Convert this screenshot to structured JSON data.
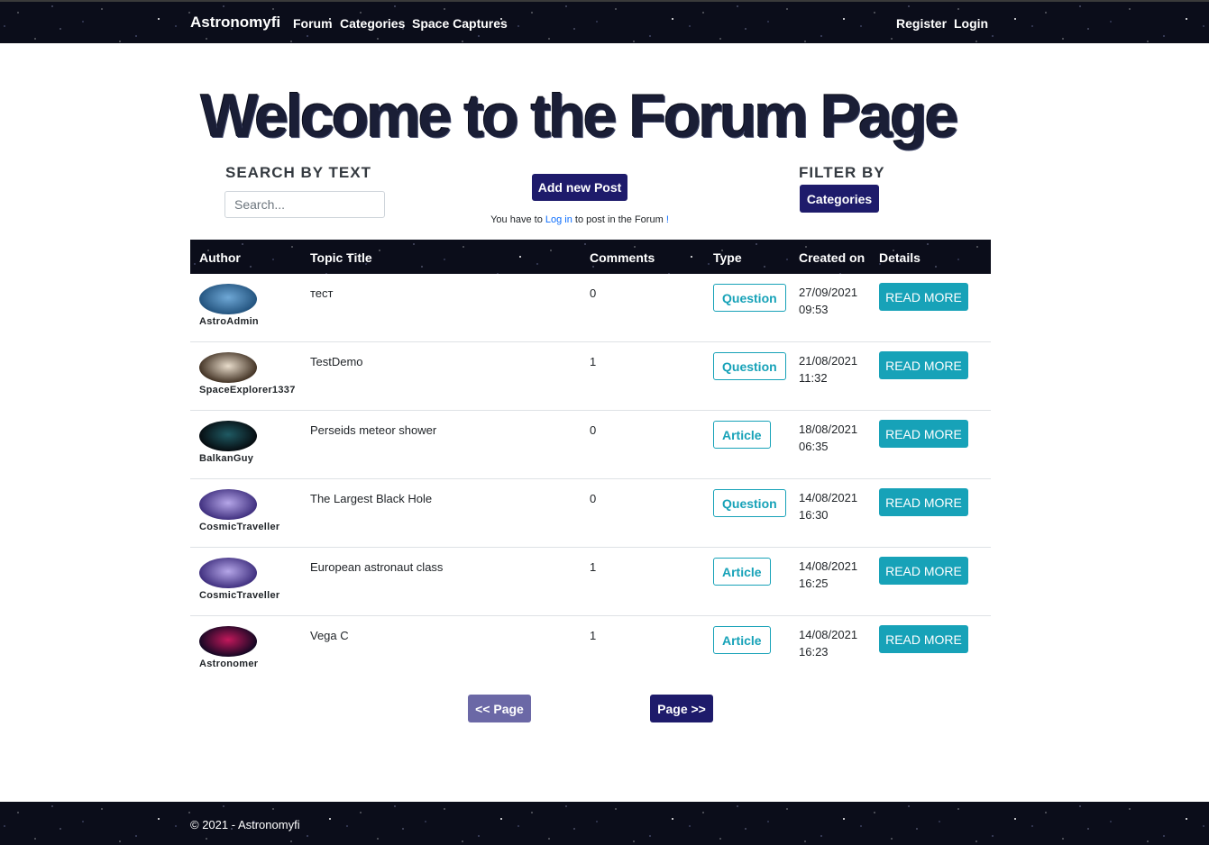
{
  "navbar": {
    "brand": "Astronomyfi",
    "links": [
      "Forum",
      "Categories",
      "Space Captures"
    ],
    "register": "Register",
    "login": "Login"
  },
  "hero": {
    "title": "Welcome to the Forum Page"
  },
  "search": {
    "heading": "SEARCH BY TEXT",
    "placeholder": "Search..."
  },
  "add_post": {
    "button": "Add new Post",
    "notice_before": "You have to",
    "notice_link": "Log in",
    "notice_after": "to post in the Forum",
    "notice_end": "!"
  },
  "filter": {
    "heading": "FILTER BY",
    "button": "Categories"
  },
  "table": {
    "headers": [
      "Author",
      "Topic Title",
      "Comments",
      "Type",
      "Created on",
      "Details"
    ],
    "rows": [
      {
        "author": "AstroAdmin",
        "title": "тест",
        "comments": "0",
        "type": "Question",
        "date": "27/09/2021",
        "time": "09:53",
        "details": "READ MORE",
        "avatar_colors": [
          "#6fa8d6",
          "#1f4f7a"
        ]
      },
      {
        "author": "SpaceExplorer1337",
        "title": "TestDemo",
        "comments": "1",
        "type": "Question",
        "date": "21/08/2021",
        "time": "11:32",
        "details": "READ MORE",
        "avatar_colors": [
          "#e8dccb",
          "#3a2a1c"
        ]
      },
      {
        "author": "BalkanGuy",
        "title": "Perseids meteor shower",
        "comments": "0",
        "type": "Article",
        "date": "18/08/2021",
        "time": "06:35",
        "details": "READ MORE",
        "avatar_colors": [
          "#1f5a63",
          "#05080c"
        ]
      },
      {
        "author": "CosmicTraveller",
        "title": "The Largest Black Hole",
        "comments": "0",
        "type": "Question",
        "date": "14/08/2021",
        "time": "16:30",
        "details": "READ MORE",
        "avatar_colors": [
          "#b5a6e8",
          "#3a2a7a"
        ]
      },
      {
        "author": "CosmicTraveller",
        "title": "European astronaut class",
        "comments": "1",
        "type": "Article",
        "date": "14/08/2021",
        "time": "16:25",
        "details": "READ MORE",
        "avatar_colors": [
          "#b5a6e8",
          "#3a2a7a"
        ]
      },
      {
        "author": "Astronomer",
        "title": "Vega C",
        "comments": "1",
        "type": "Article",
        "date": "14/08/2021",
        "time": "16:23",
        "details": "READ MORE",
        "avatar_colors": [
          "#c2185b",
          "#0a0620"
        ]
      }
    ]
  },
  "pagination": {
    "prev": "<< Page",
    "next": "Page >>"
  },
  "footer": {
    "text": "© 2021 - Astronomyfi"
  },
  "colors": {
    "navy": "#1e1b6b",
    "navy_disabled": "#6b68a6",
    "teal": "#17a2b8",
    "header_dark": "#0b0d1a"
  }
}
